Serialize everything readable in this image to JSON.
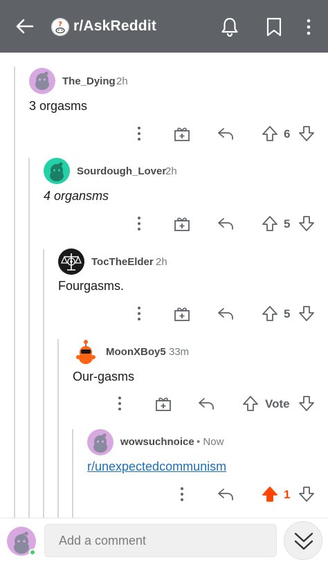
{
  "header": {
    "title": "r/AskReddit",
    "back_icon": "arrow-left-icon",
    "bell_icon": "bell-icon",
    "bookmark_icon": "bookmark-icon",
    "more_icon": "more-vertical-icon",
    "bg_color": "#5f6368"
  },
  "comments": [
    {
      "username": "The_Dying",
      "time": "2h",
      "body": "3 orgasms",
      "score": "6",
      "avatar_color": "#d8a8e0"
    },
    {
      "username": "Sourdough_Lover",
      "time": "2h",
      "body": "4 organsms",
      "score": "5",
      "avatar_color": "#24d0a6"
    },
    {
      "username": "TocTheElder",
      "time": "2h",
      "body": "Fourgasms.",
      "score": "5",
      "avatar_color": "#1a1a1b"
    },
    {
      "username": "MoonXBoy5",
      "time": "33m",
      "body": "Our-gasms",
      "score": "Vote",
      "avatar_color": "#ff6314"
    },
    {
      "username": "wowsuchnoice",
      "time": "• Now",
      "body": "r/unexpectedcommunism",
      "score": "1",
      "avatar_color": "#d8a8e0"
    }
  ],
  "bottom": {
    "placeholder": "Add a comment",
    "next_icon": "double-chevron-down-icon",
    "accent_upvote": "#ff4500",
    "online_color": "#46d160"
  }
}
